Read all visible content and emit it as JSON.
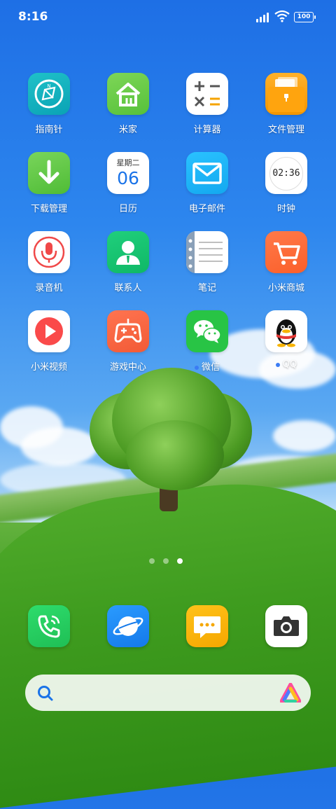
{
  "status_bar": {
    "time": "8:16",
    "battery": "100"
  },
  "apps": [
    {
      "label": "指南针",
      "icon": "compass-icon"
    },
    {
      "label": "米家",
      "icon": "mi-home-icon"
    },
    {
      "label": "计算器",
      "icon": "calculator-icon"
    },
    {
      "label": "文件管理",
      "icon": "file-manager-icon"
    },
    {
      "label": "下载管理",
      "icon": "download-icon"
    },
    {
      "label": "日历",
      "icon": "calendar-icon",
      "weekday": "星期二",
      "day": "06"
    },
    {
      "label": "电子邮件",
      "icon": "mail-icon"
    },
    {
      "label": "时钟",
      "icon": "clock-icon",
      "time": "02:36"
    },
    {
      "label": "录音机",
      "icon": "microphone-icon"
    },
    {
      "label": "联系人",
      "icon": "contact-icon"
    },
    {
      "label": "笔记",
      "icon": "notes-icon"
    },
    {
      "label": "小米商城",
      "icon": "shopping-cart-icon"
    },
    {
      "label": "小米视频",
      "icon": "video-play-icon"
    },
    {
      "label": "游戏中心",
      "icon": "gamepad-icon"
    },
    {
      "label": "微信",
      "icon": "wechat-icon",
      "has_notification_dot": true
    },
    {
      "label": "QQ",
      "icon": "qq-penguin-icon",
      "has_notification_dot": true
    }
  ],
  "page_indicator": {
    "count": 3,
    "active_index": 2
  },
  "dock": [
    {
      "icon": "phone-icon",
      "color": "#22c55e"
    },
    {
      "icon": "browser-planet-icon",
      "color": "#1e8ef5"
    },
    {
      "icon": "message-icon",
      "color": "#f5b400"
    },
    {
      "icon": "camera-icon",
      "color": "#ffffff"
    }
  ],
  "search_bar": {
    "icon": "search-icon",
    "assistant_icon": "ai-assistant-icon"
  },
  "colors": {
    "accent_blue": "#3b7cf4"
  }
}
